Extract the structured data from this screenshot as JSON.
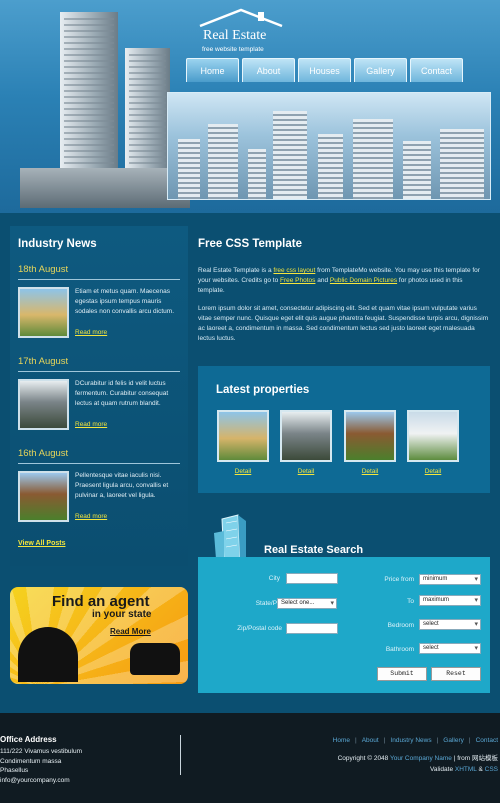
{
  "logo": {
    "name": "Real Estate",
    "tagline": "free website template"
  },
  "nav": [
    {
      "label": "Home",
      "active": true
    },
    {
      "label": "About"
    },
    {
      "label": "Houses"
    },
    {
      "label": "Gallery"
    },
    {
      "label": "Contact"
    }
  ],
  "left": {
    "title": "Industry News",
    "news": [
      {
        "date": "18th August",
        "text": "Etiam et metus quam. Maecenas egestas ipsum tempus mauris sodales non convallis arcu dictum.",
        "more": "Read more"
      },
      {
        "date": "17th August",
        "text": "DCurabitur id felis id velit luctus fermentum. Curabitur consequat lectus at quam rutrum blandit.",
        "more": "Read more"
      },
      {
        "date": "16th August",
        "text": "Pellentesque vitae iaculis nisi. Praesent ligula arcu, convallis et pulvinar a, laoreet vel ligula.",
        "more": "Read more"
      }
    ],
    "view_all": "View All Posts"
  },
  "agent": {
    "line1": "Find an agent",
    "line2": "in your state",
    "cta": "Read More"
  },
  "main": {
    "title": "Free CSS Template",
    "p1_a": "Real Estate Template is a ",
    "p1_link1": "free css layout",
    "p1_b": " from TemplateMo website. You may use this template for your websites. Credits go to ",
    "p1_link2": "Free Photos",
    "p1_c": " and ",
    "p1_link3": "Public Domain Pictures",
    "p1_d": " for photos used in this template.",
    "p2": "Lorem ipsum dolor sit amet, consectetur adipiscing elit. Sed et quam vitae ipsum vulputate varius vitae semper nunc. Quisque eget elit quis augue pharetra feugiat. Suspendisse turpis arcu, dignissim ac laoreet a, condimentum in massa. Sed condimentum lectus sed justo laoreet eget malesuada lectus luctus."
  },
  "properties": {
    "title": "Latest properties",
    "items": [
      {
        "link": "Detail"
      },
      {
        "link": "Detail"
      },
      {
        "link": "Detail"
      },
      {
        "link": "Detail"
      }
    ]
  },
  "search": {
    "title": "Real Estate Search",
    "city_label": "City",
    "state_label": "State/Province",
    "state_value": "Select one...",
    "zip_label": "Zip/Postal code",
    "price_label": "Price from",
    "price_value": "minimum",
    "to_label": "To",
    "to_value": "maximum",
    "bedroom_label": "Bedroom",
    "bedroom_value": "select",
    "bathroom_label": "Bathroom",
    "bathroom_value": "select",
    "submit": "Submit",
    "reset": "Reset"
  },
  "footer": {
    "addr_title": "Office Address",
    "addr_lines": [
      "111/222 Vivamus vestibulum",
      "Condimentum massa",
      "Phasellus",
      "info@yourcompany.com"
    ],
    "nav": [
      "Home",
      "About",
      "Industry News",
      "Gallery",
      "Contact"
    ],
    "copy_a": "Copyright © 2048 ",
    "company": "Your Company Name",
    "copy_b": " | from 网站模板",
    "validate": "Validate ",
    "xhtml": "XHTML",
    "amp": " & ",
    "css": "CSS"
  }
}
